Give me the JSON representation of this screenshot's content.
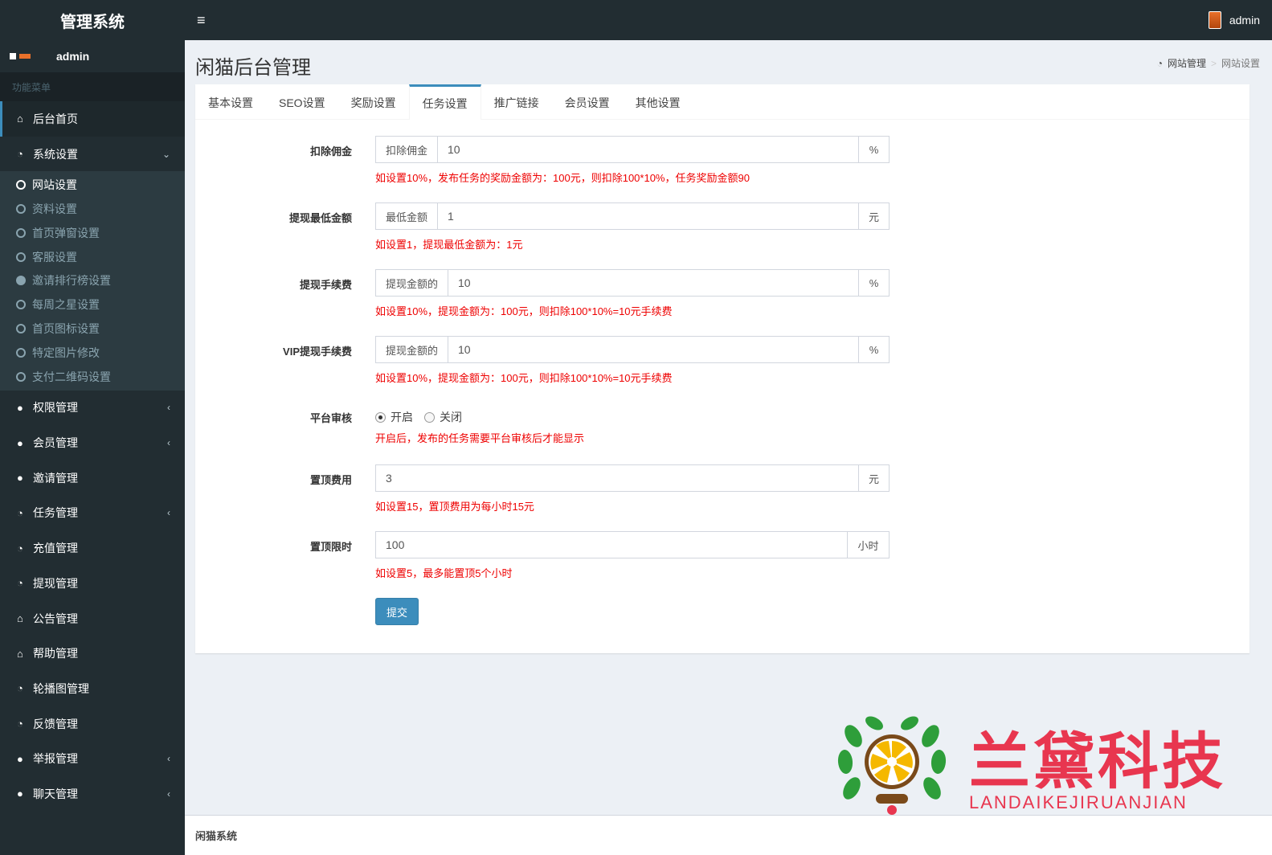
{
  "app": {
    "logo_text": "管理系统",
    "toggle_icon": "≡",
    "user": "admin"
  },
  "sidebar": {
    "user": "admin",
    "menu_header": "功能菜单",
    "items": [
      {
        "label": "后台首页",
        "icon": "home-icon",
        "active": true
      },
      {
        "label": "系统设置",
        "icon": "dashboard-icon",
        "chevron": "⌄"
      },
      {
        "label": "权限管理",
        "icon": "users-icon",
        "chevron": "‹"
      },
      {
        "label": "会员管理",
        "icon": "users-icon",
        "chevron": "‹"
      },
      {
        "label": "邀请管理",
        "icon": "users-icon"
      },
      {
        "label": "任务管理",
        "icon": "dashboard-icon",
        "chevron": "‹"
      },
      {
        "label": "充值管理",
        "icon": "dashboard-icon"
      },
      {
        "label": "提现管理",
        "icon": "dashboard-icon"
      },
      {
        "label": "公告管理",
        "icon": "home-icon"
      },
      {
        "label": "帮助管理",
        "icon": "home-icon"
      },
      {
        "label": "轮播图管理",
        "icon": "dashboard-icon"
      },
      {
        "label": "反馈管理",
        "icon": "dashboard-icon"
      },
      {
        "label": "举报管理",
        "icon": "users-icon",
        "chevron": "‹"
      },
      {
        "label": "聊天管理",
        "icon": "users-icon",
        "chevron": "‹"
      }
    ],
    "submenu": [
      {
        "label": "网站设置",
        "active": true
      },
      {
        "label": "资料设置"
      },
      {
        "label": "首页弹窗设置"
      },
      {
        "label": "客服设置"
      },
      {
        "label": "邀请排行榜设置"
      },
      {
        "label": "每周之星设置"
      },
      {
        "label": "首页图标设置"
      },
      {
        "label": "特定图片修改"
      },
      {
        "label": "支付二维码设置"
      }
    ]
  },
  "page": {
    "title": "闲猫后台管理",
    "breadcrumb": [
      "网站管理",
      "网站设置"
    ],
    "breadcrumb_sep": ">"
  },
  "tabs": [
    "基本设置",
    "SEO设置",
    "奖励设置",
    "任务设置",
    "推广链接",
    "会员设置",
    "其他设置"
  ],
  "active_tab": "任务设置",
  "form": {
    "deduct": {
      "label": "扣除佣金",
      "prefix": "扣除佣金",
      "value": "10",
      "suffix": "%",
      "help": "如设置10%，发布任务的奖励金额为：100元，则扣除100*10%，任务奖励金额90"
    },
    "min_withdraw": {
      "label": "提现最低金额",
      "prefix": "最低金额",
      "value": "1",
      "suffix": "元",
      "help": "如设置1，提现最低金额为：1元"
    },
    "withdraw_fee": {
      "label": "提现手续费",
      "prefix": "提现金额的",
      "value": "10",
      "suffix": "%",
      "help": "如设置10%，提现金额为：100元，则扣除100*10%=10元手续费"
    },
    "vip_withdraw_fee": {
      "label": "VIP提现手续费",
      "prefix": "提现金额的",
      "value": "10",
      "suffix": "%",
      "help": "如设置10%，提现金额为：100元，则扣除100*10%=10元手续费"
    },
    "audit": {
      "label": "平台审核",
      "on": "开启",
      "off": "关闭",
      "help": "开启后，发布的任务需要平台审核后才能显示"
    },
    "top_fee": {
      "label": "置顶费用",
      "value": "3",
      "suffix": "元",
      "help": "如设置15，置顶费用为每小时15元"
    },
    "top_limit": {
      "label": "置顶限时",
      "value": "100",
      "suffix": "小时",
      "help": "如设置5，最多能置顶5个小时"
    },
    "submit": "提交"
  },
  "footer": {
    "text": "闲猫系统"
  },
  "watermark": {
    "cn": "兰黛科技",
    "en": "LANDAIKEJIRUANJIAN"
  },
  "colors": {
    "sidebar": "#222d32",
    "accent": "#3c8dbc",
    "help": "#ee0000",
    "watermark": "#e8364f"
  }
}
